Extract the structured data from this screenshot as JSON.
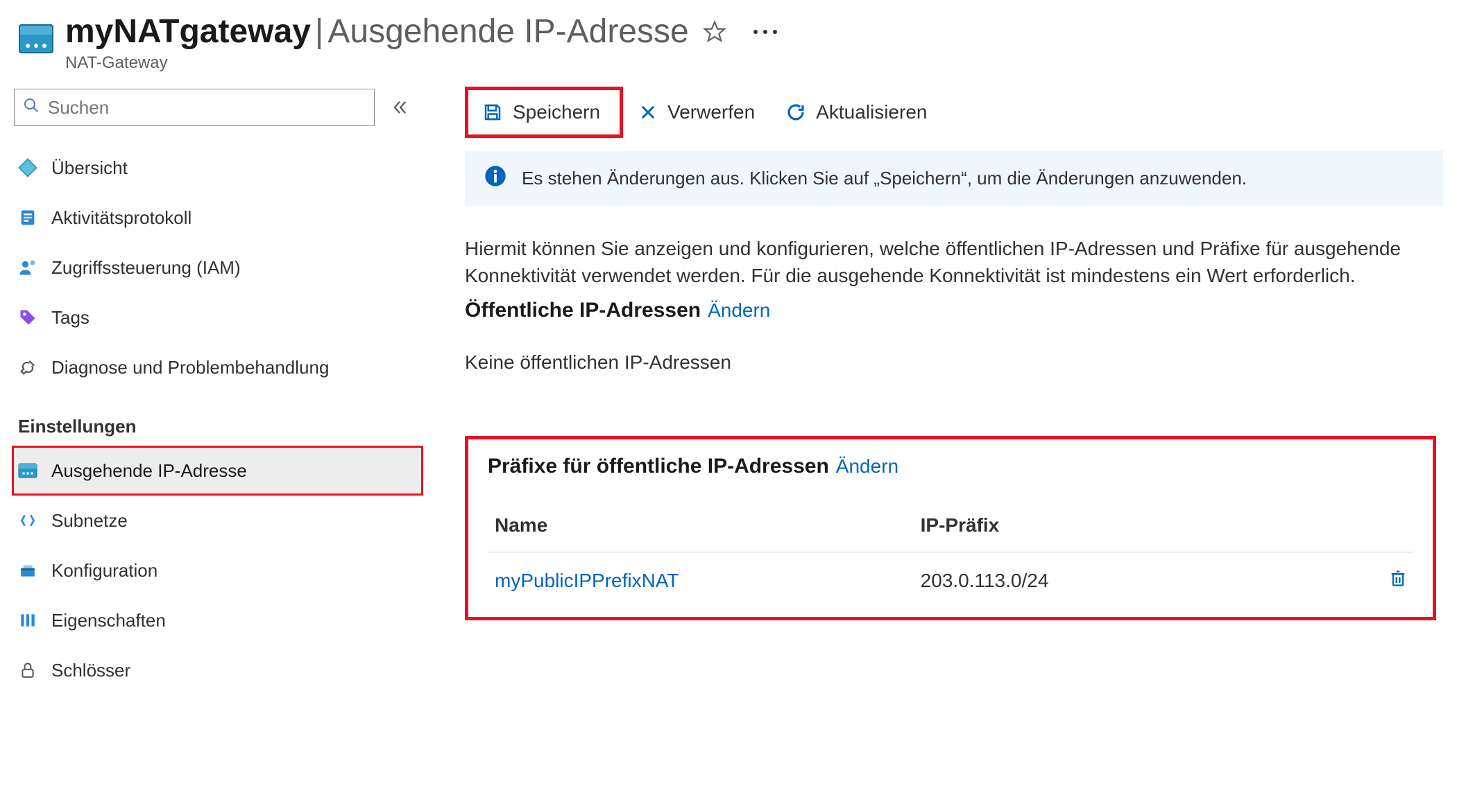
{
  "header": {
    "resource_name": "myNATgateway",
    "page_title": "Ausgehende IP-Adresse",
    "subtitle": "NAT-Gateway"
  },
  "sidebar": {
    "search_placeholder": "Suchen",
    "items_top": [
      {
        "label": "Übersicht"
      },
      {
        "label": "Aktivitätsprotokoll"
      },
      {
        "label": "Zugriffssteuerung (IAM)"
      },
      {
        "label": "Tags"
      },
      {
        "label": "Diagnose und Problembehandlung"
      }
    ],
    "section_title": "Einstellungen",
    "items_settings": [
      {
        "label": "Ausgehende IP-Adresse"
      },
      {
        "label": "Subnetze"
      },
      {
        "label": "Konfiguration"
      },
      {
        "label": "Eigenschaften"
      },
      {
        "label": "Schlösser"
      }
    ]
  },
  "toolbar": {
    "save": "Speichern",
    "discard": "Verwerfen",
    "refresh": "Aktualisieren"
  },
  "info_message": "Es stehen Änderungen aus. Klicken Sie auf „Speichern“, um die Änderungen anzuwenden.",
  "description": "Hiermit können Sie anzeigen und konfigurieren, welche öffentlichen IP-Adressen und Präfixe für ausgehende Konnektivität verwendet werden. Für die ausgehende Konnektivität ist mindestens ein Wert erforderlich.",
  "public_ip": {
    "title": "Öffentliche IP-Adressen",
    "change": "Ändern",
    "empty": "Keine öffentlichen IP-Adressen"
  },
  "prefix": {
    "title": "Präfixe für öffentliche IP-Adressen",
    "change": "Ändern",
    "col_name": "Name",
    "col_ip": "IP-Präfix",
    "rows": [
      {
        "name": "myPublicIPPrefixNAT",
        "ip": "203.0.113.0/24"
      }
    ]
  }
}
